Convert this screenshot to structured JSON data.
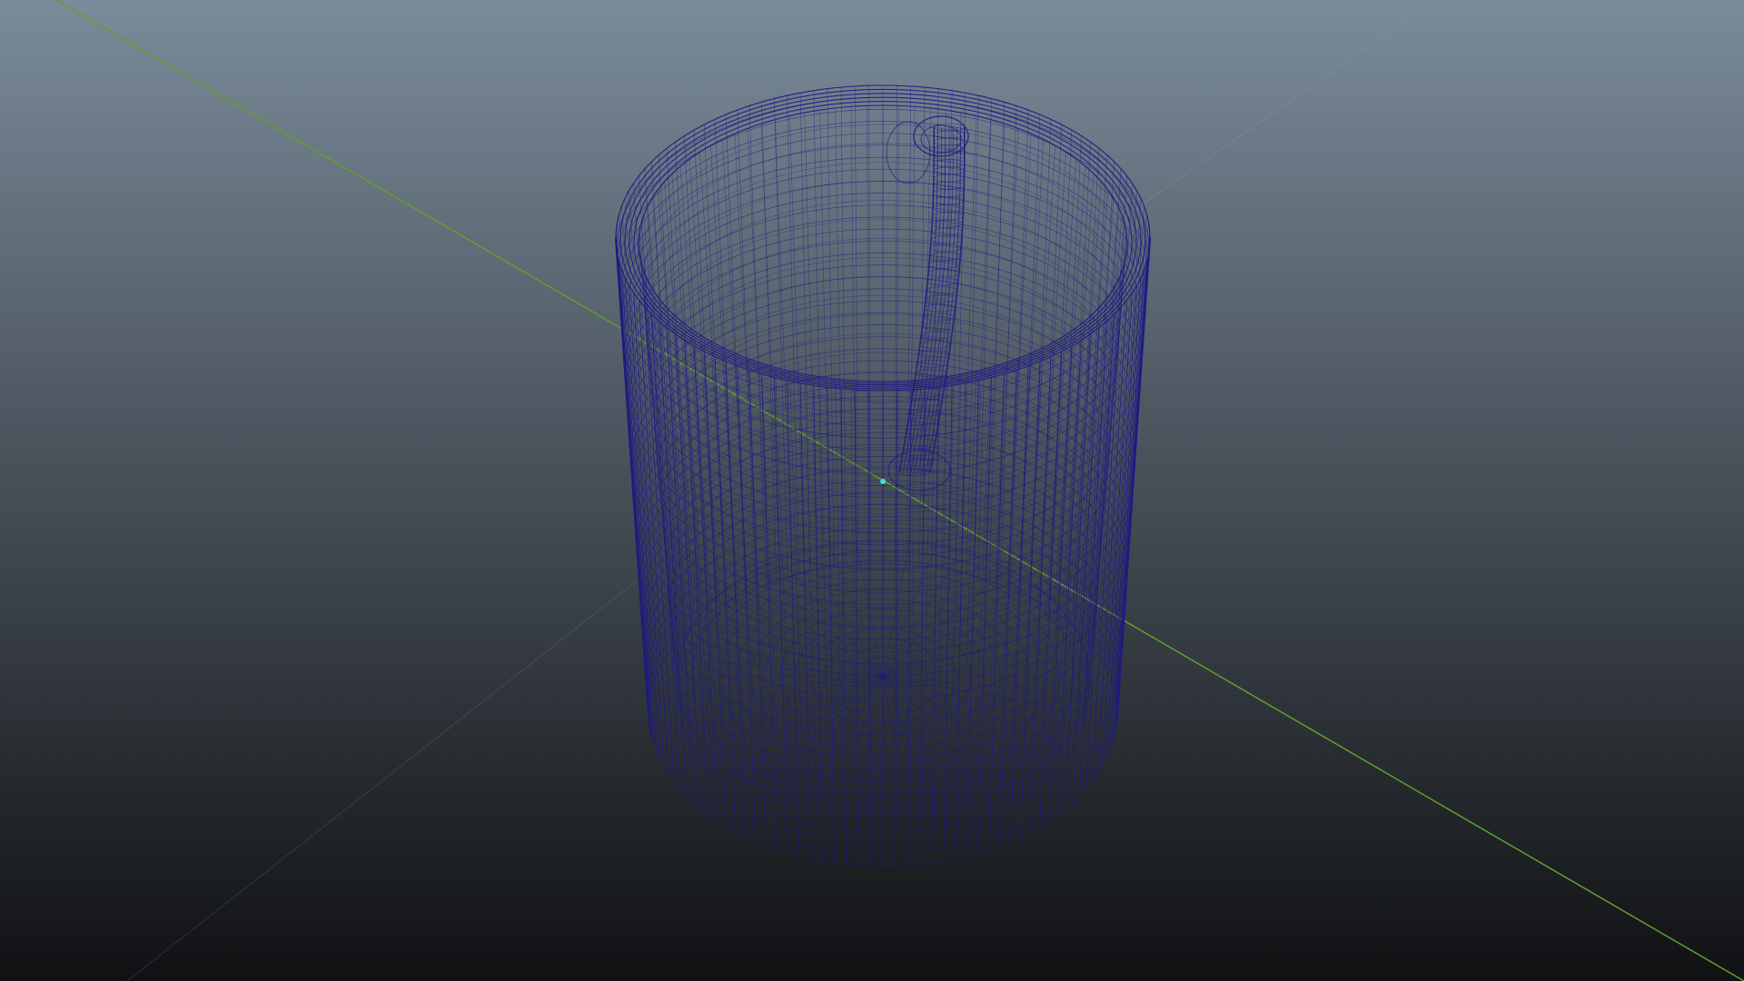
{
  "viewport": {
    "panel": "3d-perspective-viewport",
    "display_mode": "wireframe",
    "background_gradient": {
      "top": "#7B8B9A",
      "bottom": "#101113"
    },
    "colors": {
      "wireframe": "#1E1A82",
      "wireframe_shadow": "#15125A",
      "grid_axis_green": "#5FA02A",
      "grid_axis_faint": "#8A98A6",
      "pivot": "#3CE0D0"
    },
    "object": {
      "shape": "mug",
      "parts": [
        "outer-wall",
        "inner-wall",
        "rim",
        "base",
        "handle"
      ]
    }
  }
}
